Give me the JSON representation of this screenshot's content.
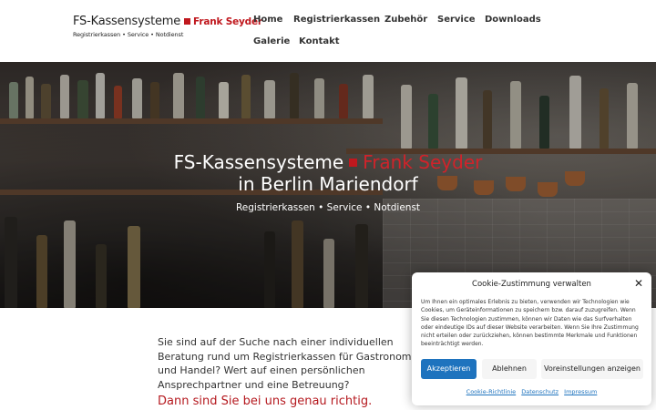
{
  "header": {
    "logo": {
      "brand": "FS-Kassensysteme",
      "owner": "Frank Seyder",
      "tagline": "Registrierkassen • Service • Notdienst"
    },
    "nav": [
      {
        "label": "Home"
      },
      {
        "label": "Registrierkassen"
      },
      {
        "label": "Zubehör"
      },
      {
        "label": "Service"
      },
      {
        "label": "Downloads"
      },
      {
        "label": "Galerie"
      },
      {
        "label": "Kontakt"
      }
    ]
  },
  "hero": {
    "title_brand": "FS-Kassensysteme",
    "title_owner": "Frank Seyder",
    "subtitle": "in Berlin Mariendorf",
    "tags": "Registrierkassen •  Service •  Notdienst"
  },
  "intro": {
    "text": "Sie sind auf der Suche nach einer individuellen Beratung rund um Registrierkassen für Gastronomie und Handel? Wert auf einen persönlichen Ansprechpartner und eine Betreuung?",
    "cta": "Dann sind Sie bei uns genau richtig."
  },
  "cookie": {
    "title": "Cookie-Zustimmung verwalten",
    "close": "✕",
    "text": "Um Ihnen ein optimales Erlebnis zu bieten, verwenden wir Technologien wie Cookies, um Geräteinformationen zu speichern bzw. darauf zuzugreifen. Wenn Sie diesen Technologien zustimmen, können wir Daten wie das Surfverhalten oder eindeutige IDs auf dieser Website verarbeiten. Wenn Sie Ihre Zustimmung nicht erteilen oder zurückziehen, können bestimmte Merkmale und Funktionen beeinträchtigt werden.",
    "accept": "Akzeptieren",
    "deny": "Ablehnen",
    "preferences": "Voreinstellungen anzeigen",
    "links": {
      "policy": "Cookie-Richtlinie",
      "privacy": "Datenschutz",
      "imprint": "Impressum"
    }
  },
  "colors": {
    "accent": "#c0181e",
    "button": "#1e73be"
  }
}
